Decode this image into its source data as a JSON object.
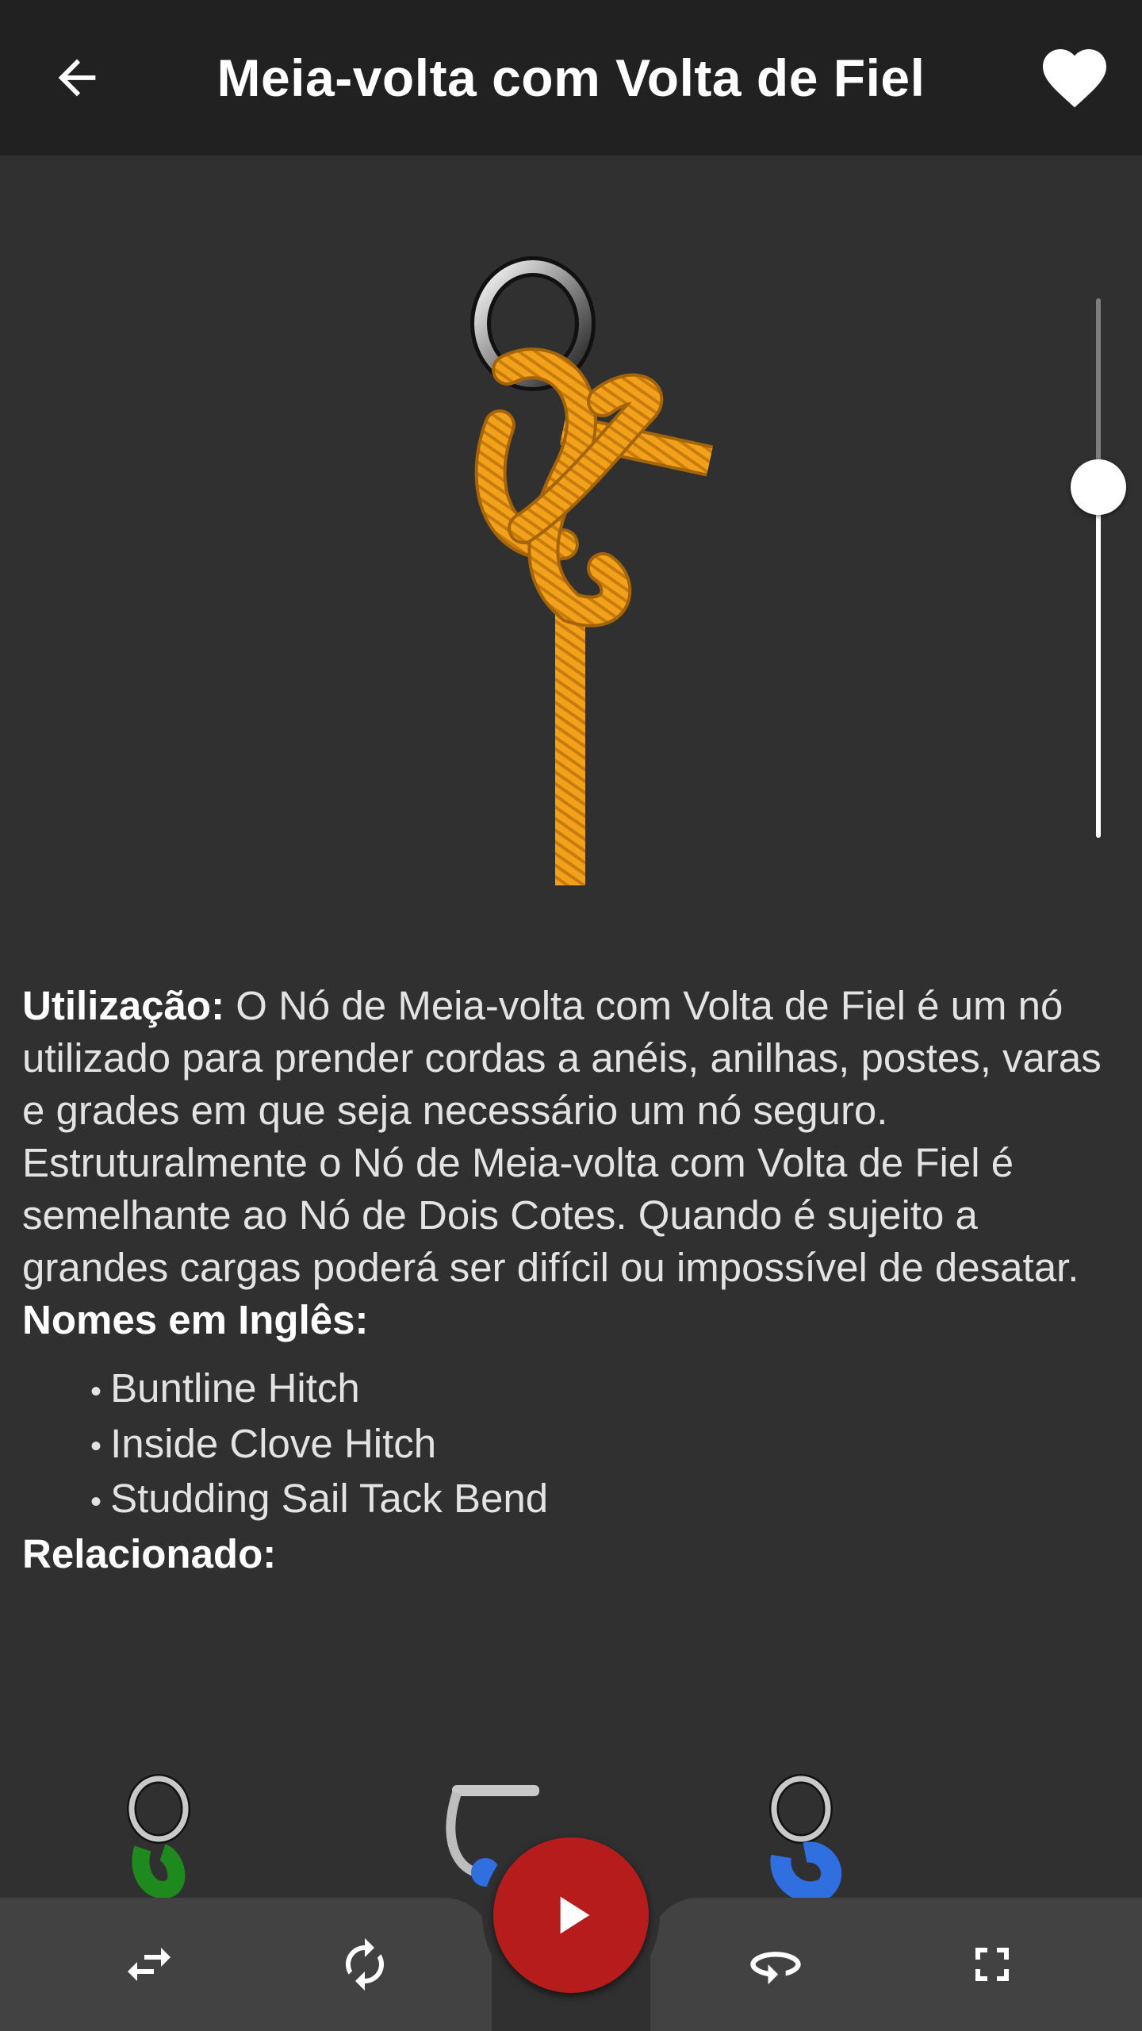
{
  "appbar": {
    "title": "Meia-volta com Volta de Fiel",
    "back_icon": "arrow-left-icon",
    "favorite_icon": "heart-icon"
  },
  "viewer": {
    "knot_image": "knot-animation-frame",
    "step_slider_value": 0.5
  },
  "usage": {
    "label": "Utilização:",
    "text": " O Nó de Meia-volta com Volta de Fiel é um nó utilizado para prender cordas a anéis, anilhas, postes, varas e grades em que seja necessário um nó seguro. Estruturalmente o Nó de Meia-volta com Volta de Fiel é semelhante ao Nó de Dois Cotes. Quando é sujeito a grandes cargas poderá ser difícil ou impossível de desatar."
  },
  "english_names": {
    "title": "Nomes em Inglês:",
    "items": [
      "Buntline Hitch",
      "Inside Clove Hitch",
      "Studding Sail Tack Bend"
    ]
  },
  "related": {
    "title": "Relacionado:",
    "colors": [
      "#1e8a1e",
      "#2f6fe0",
      "#2f6fe0"
    ]
  },
  "bottombar": {
    "swap_icon": "swap-arrows-icon",
    "repeat_icon": "repeat-icon",
    "play_icon": "play-icon",
    "rotate_icon": "rotate-360-icon",
    "fullscreen_icon": "fullscreen-icon",
    "play_color": "#b71c1c"
  },
  "colors": {
    "background": "#303030",
    "appbar": "#212121",
    "rope": "#f2a21a",
    "bottombar": "#424242"
  }
}
